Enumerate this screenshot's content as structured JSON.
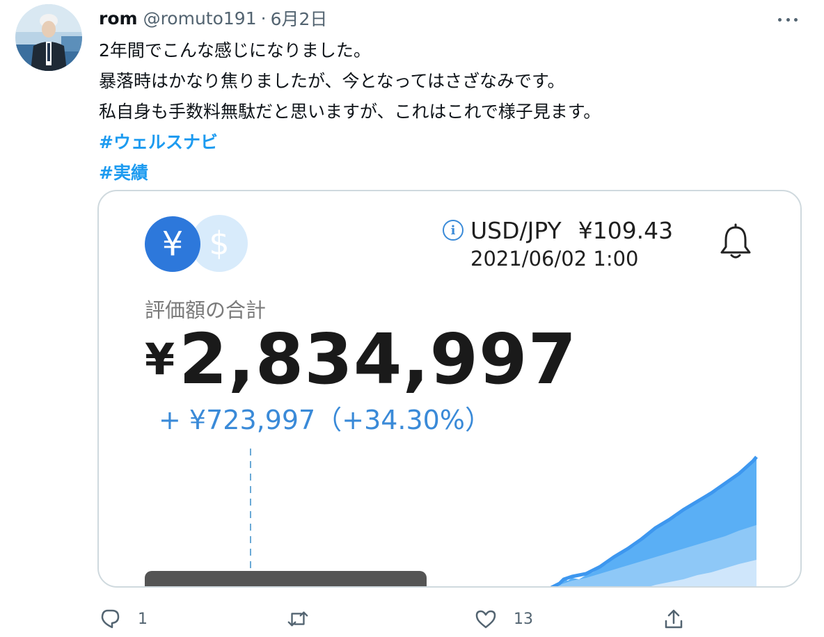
{
  "tweet": {
    "author_name": "rom",
    "author_handle": "@romuto191",
    "separator": "·",
    "date": "6月2日",
    "lines": [
      "2年間でこんな感じになりました。",
      "暴落時はかなり焦りましたが、今となってはさざなみです。",
      "私自身も手数料無駄だと思いますが、これはこれで様子見ます。"
    ],
    "hashtags": [
      "#ウェルスナビ",
      "#実績"
    ]
  },
  "card": {
    "yen_symbol": "¥",
    "usd_symbol": "$",
    "info_symbol": "i",
    "fx_pair": "USD/JPY",
    "fx_rate": "¥109.43",
    "fx_date": "2021/06/02 1:00",
    "total_label": "評価額の合計",
    "total_currency": "¥",
    "total_value": "2,834,997",
    "gain": "+ ¥723,997（+34.30%）"
  },
  "actions": {
    "reply_count": "1",
    "retweet_count": "",
    "like_count": "13"
  },
  "colors": {
    "accent": "#1d9bf0",
    "chart_fill": "#5aaff5",
    "chart_light": "#cfe6fb",
    "yen_circle": "#2d78db"
  },
  "icons": [
    "reply-icon",
    "retweet-icon",
    "like-icon",
    "share-icon",
    "bell-icon",
    "info-icon",
    "more-icon"
  ]
}
